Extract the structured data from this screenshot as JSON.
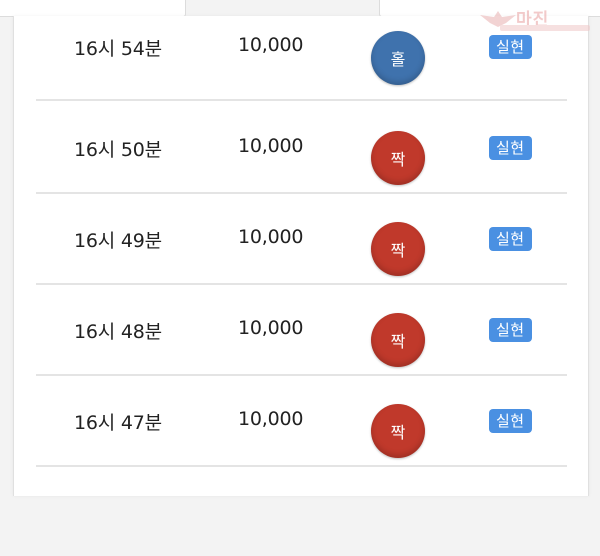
{
  "watermark": {
    "label": "마진"
  },
  "colors": {
    "hol": "#3f72ad",
    "jjak": "#c0392b",
    "badge": "#4a90e2"
  },
  "rows": [
    {
      "time": "16시 54분",
      "amount": "10,000",
      "result": "홀",
      "result_type": "hol",
      "status": "실현"
    },
    {
      "time": "16시 50분",
      "amount": "10,000",
      "result": "짝",
      "result_type": "jjak",
      "status": "실현"
    },
    {
      "time": "16시 49분",
      "amount": "10,000",
      "result": "짝",
      "result_type": "jjak",
      "status": "실현"
    },
    {
      "time": "16시 48분",
      "amount": "10,000",
      "result": "짝",
      "result_type": "jjak",
      "status": "실현"
    },
    {
      "time": "16시 47분",
      "amount": "10,000",
      "result": "짝",
      "result_type": "jjak",
      "status": "실현"
    }
  ]
}
